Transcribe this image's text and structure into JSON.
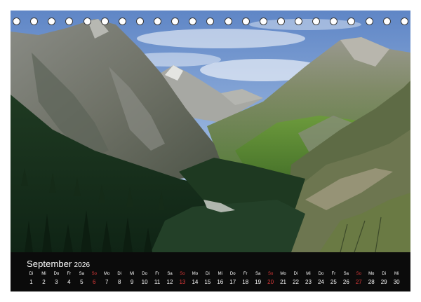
{
  "calendar": {
    "month": "September",
    "year": "2026",
    "days": [
      {
        "name": "Di",
        "num": "1"
      },
      {
        "name": "Mi",
        "num": "2"
      },
      {
        "name": "Do",
        "num": "3"
      },
      {
        "name": "Fr",
        "num": "4"
      },
      {
        "name": "Sa",
        "num": "5"
      },
      {
        "name": "So",
        "num": "6",
        "sunday": true
      },
      {
        "name": "Mo",
        "num": "7"
      },
      {
        "name": "Di",
        "num": "8"
      },
      {
        "name": "Mi",
        "num": "9"
      },
      {
        "name": "Do",
        "num": "10"
      },
      {
        "name": "Fr",
        "num": "11"
      },
      {
        "name": "Sa",
        "num": "12"
      },
      {
        "name": "So",
        "num": "13",
        "sunday": true
      },
      {
        "name": "Mo",
        "num": "14"
      },
      {
        "name": "Di",
        "num": "15"
      },
      {
        "name": "Mi",
        "num": "16"
      },
      {
        "name": "Do",
        "num": "17"
      },
      {
        "name": "Fr",
        "num": "18"
      },
      {
        "name": "Sa",
        "num": "19"
      },
      {
        "name": "So",
        "num": "20",
        "sunday": true
      },
      {
        "name": "Mo",
        "num": "21"
      },
      {
        "name": "Di",
        "num": "22"
      },
      {
        "name": "Mi",
        "num": "23"
      },
      {
        "name": "Do",
        "num": "24"
      },
      {
        "name": "Fr",
        "num": "25"
      },
      {
        "name": "Sa",
        "num": "26"
      },
      {
        "name": "So",
        "num": "27",
        "sunday": true
      },
      {
        "name": "Mo",
        "num": "28"
      },
      {
        "name": "Di",
        "num": "29"
      },
      {
        "name": "Mi",
        "num": "30"
      }
    ]
  },
  "binding": {
    "ring_count": 23
  },
  "colors": {
    "calendar_bar": "#0b0b0b",
    "day_text": "#ffffff",
    "sunday_text": "#e03a3a",
    "ring_border": "#3a3a3a"
  }
}
